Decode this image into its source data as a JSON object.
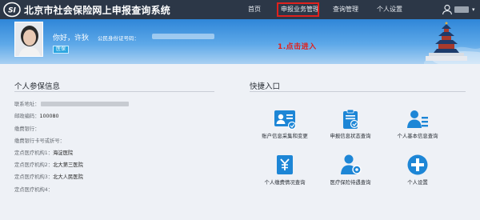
{
  "header": {
    "system_title": "北京市社会保险网上申报查询系统",
    "nav": [
      {
        "label": "首页"
      },
      {
        "label": "申报业务管理"
      },
      {
        "label": "查询管理"
      },
      {
        "label": "个人设置"
      }
    ],
    "user_caret": "▾"
  },
  "banner": {
    "greeting": "你好，许狄",
    "id_label": "公民身份证号码：",
    "badge": "医保",
    "callout": "1.点击进入"
  },
  "personal_info": {
    "title": "个人参保信息",
    "rows": [
      {
        "label": "联系地址：",
        "value": ""
      },
      {
        "label": "邮政编码：",
        "value": "100080"
      },
      {
        "label": "缴费银行：",
        "value": ""
      },
      {
        "label": "缴费银行卡号或折号：",
        "value": ""
      },
      {
        "label": "定点医疗机构1：",
        "value": "海淀医院"
      },
      {
        "label": "定点医疗机构2：",
        "value": "北大第三医院"
      },
      {
        "label": "定点医疗机构3：",
        "value": "北大人民医院"
      },
      {
        "label": "定点医疗机构4：",
        "value": ""
      }
    ]
  },
  "quick_entry": {
    "title": "快捷入口",
    "items": [
      {
        "label": "账户信息采集和变更",
        "icon": "account-card-icon"
      },
      {
        "label": "申报信息状态查询",
        "icon": "clipboard-check-icon"
      },
      {
        "label": "个人基本信息查询",
        "icon": "person-list-icon"
      },
      {
        "label": "个人缴费情况查询",
        "icon": "yuan-document-icon"
      },
      {
        "label": "医疗保险待遇查询",
        "icon": "person-gear-icon"
      },
      {
        "label": "个人设置",
        "icon": "plus-circle-icon"
      }
    ]
  },
  "colors": {
    "topbar": "#2c3747",
    "accent": "#2f86d8",
    "icon_blue": "#1d86d6",
    "highlight_red": "#e0211d"
  }
}
